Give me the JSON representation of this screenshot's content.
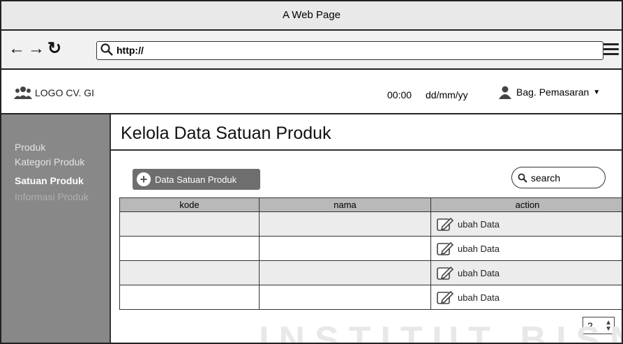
{
  "window": {
    "title": "A Web Page"
  },
  "browser": {
    "url": "http://"
  },
  "header": {
    "logo_text": "LOGO CV. GI",
    "time": "00:00",
    "date": "dd/mm/yy",
    "user": "Bag. Pemasaran"
  },
  "sidebar": {
    "items": [
      {
        "label": "Produk"
      },
      {
        "label": "Kategori Produk"
      },
      {
        "label": "Satuan Produk"
      },
      {
        "label": "Informasi Produk"
      }
    ]
  },
  "main": {
    "title": "Kelola Data Satuan Produk",
    "add_button": "Data Satuan Produk",
    "search_placeholder": "search",
    "table": {
      "headers": [
        "kode",
        "nama",
        "action"
      ],
      "rows": [
        {
          "kode": "",
          "nama": "",
          "action": "ubah Data"
        },
        {
          "kode": "",
          "nama": "",
          "action": "ubah Data"
        },
        {
          "kode": "",
          "nama": "",
          "action": "ubah Data"
        },
        {
          "kode": "",
          "nama": "",
          "action": "ubah Data"
        }
      ]
    },
    "page_number": "2"
  },
  "watermark": "INSTITUT BISNIS",
  "colors": {
    "sidebar_bg": "#888888",
    "button_bg": "#6e6e6e",
    "table_header": "#b9b9b9"
  }
}
